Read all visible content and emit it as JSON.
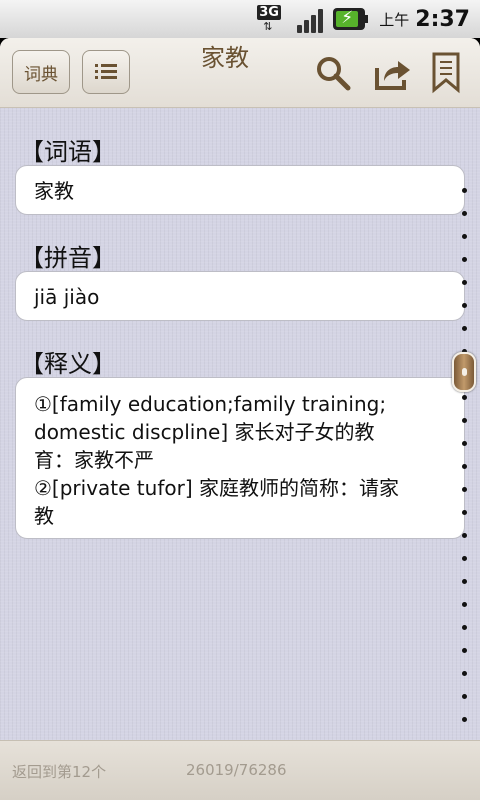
{
  "status_bar": {
    "network": "3G",
    "ampm": "上午",
    "time": "2:37",
    "battery_color": "#57b32b"
  },
  "toolbar": {
    "dict_button_label": "词典",
    "title": "家教",
    "icons": [
      "list-icon",
      "search-icon",
      "share-icon",
      "bookmark-icon"
    ],
    "accent_color": "#6a5232"
  },
  "entry": {
    "word_heading": "【词语】",
    "word": "家教",
    "pinyin_heading": "【拼音】",
    "pinyin": "jiā jiào",
    "definition_heading": "【释义】",
    "definitions": [
      "①[family education;family training;",
      "domestic discpline] 家长对子女的教",
      "育：家教不严",
      "②[private tufor] 家庭教师的简称：请家",
      "教"
    ]
  },
  "bottom_bar": {
    "back_label": "返回到第12个",
    "position": "26019/76286"
  }
}
